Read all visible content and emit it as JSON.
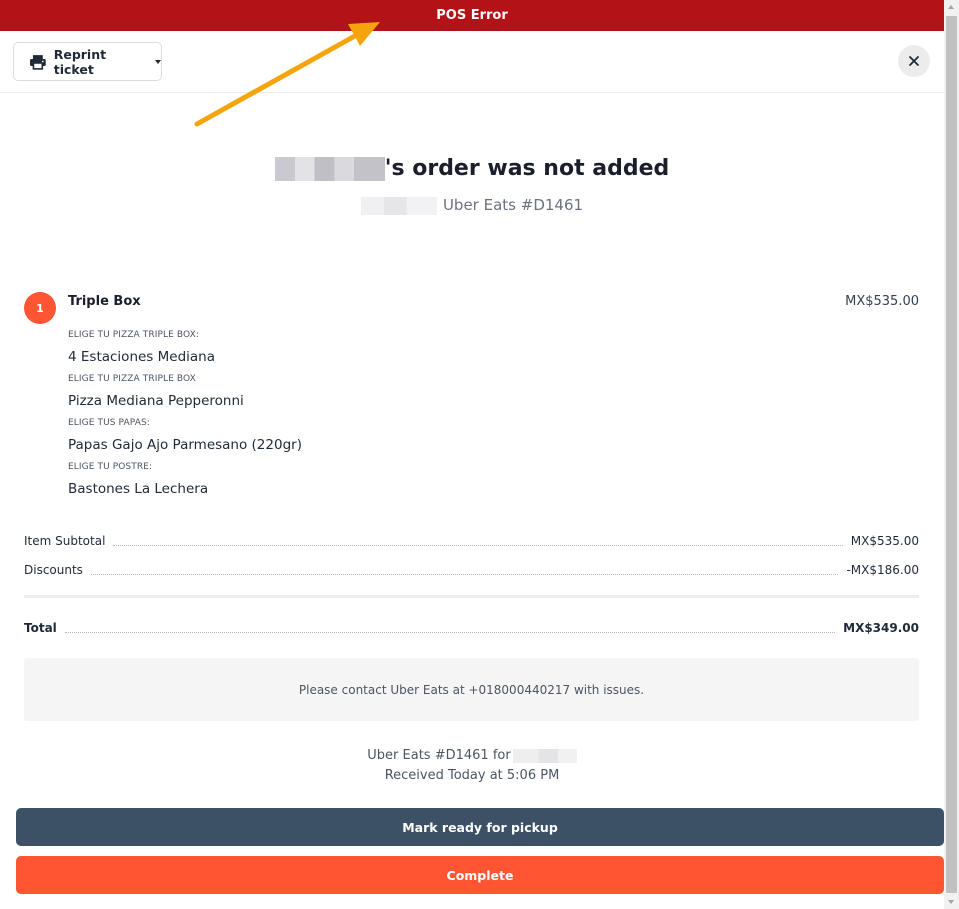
{
  "banner": {
    "title": "POS Error",
    "color": "#b31217"
  },
  "toolbar": {
    "reprint_label": "Reprint ticket",
    "reprint_icon": "printer-icon",
    "close_icon": "close-icon"
  },
  "order": {
    "headline_suffix": "'s order was not added",
    "subhead": "Uber Eats #D1461",
    "items": [
      {
        "quantity": "1",
        "name": "Triple Box",
        "price": "MX$535.00",
        "modifier_groups": [
          {
            "label": "ELIGE TU PIZZA TRIPLE BOX:",
            "option": "4 Estaciones Mediana"
          },
          {
            "label": "ELIGE TU PIZZA TRIPLE BOX",
            "option": "Pizza Mediana Pepperonni"
          },
          {
            "label": "ELIGE TUS PAPAS:",
            "option": "Papas Gajo Ajo Parmesano (220gr)"
          },
          {
            "label": "ELIGE TU POSTRE:",
            "option": "Bastones La Lechera"
          }
        ]
      }
    ]
  },
  "summary": {
    "subtotal_label": "Item Subtotal",
    "subtotal_value": "MX$535.00",
    "discounts_label": "Discounts",
    "discounts_value": "-MX$186.00",
    "total_label": "Total",
    "total_value": "MX$349.00"
  },
  "contact_message": "Please contact Uber Eats at +018000440217 with issues.",
  "footer": {
    "order_for": "Uber Eats #D1461 for",
    "received": "Received Today at 5:06 PM"
  },
  "actions": {
    "ready_label": "Mark ready for pickup",
    "complete_label": "Complete",
    "ready_color": "#3d5166",
    "complete_color": "#ff5533"
  },
  "annotation": {
    "arrow_color": "#f5a40c"
  }
}
